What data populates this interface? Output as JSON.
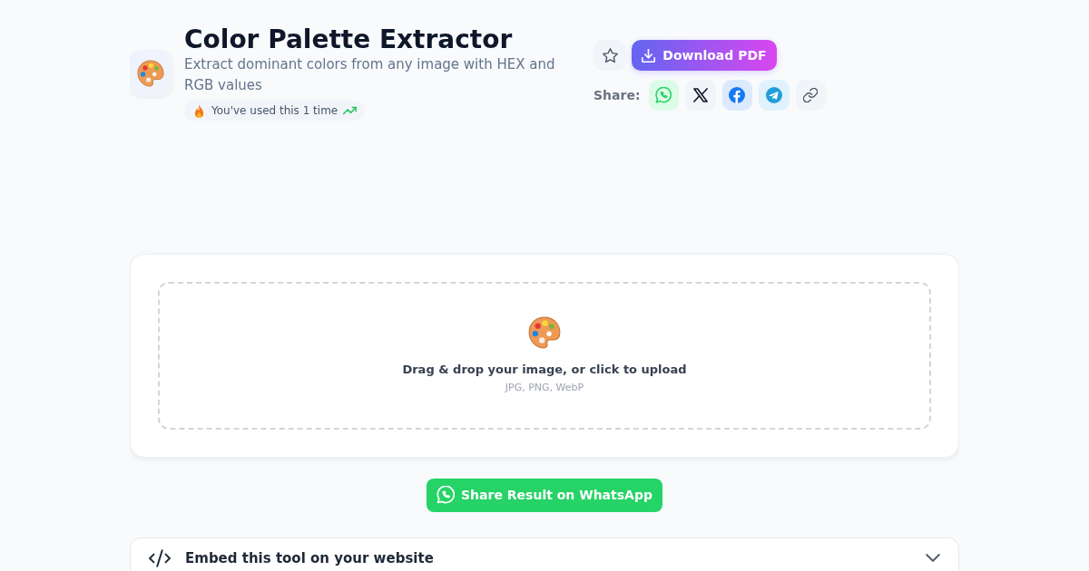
{
  "header": {
    "title": "Color Palette Extractor",
    "subtitle": "Extract dominant colors from any image with HEX and RGB values",
    "usage_badge": "You've used this 1 time"
  },
  "actions": {
    "download_button": "Download PDF",
    "share_label": "Share:",
    "share_buttons": [
      {
        "kind": "whatsapp"
      },
      {
        "kind": "x"
      },
      {
        "kind": "facebook"
      },
      {
        "kind": "telegram"
      },
      {
        "kind": "link"
      }
    ]
  },
  "upload": {
    "prompt": "Drag & drop your image, or click to upload",
    "formats": "JPG, PNG, WebP"
  },
  "share_result_button": "Share Result on WhatsApp",
  "embed": {
    "title": "Embed this tool on your website",
    "expanded": false
  }
}
